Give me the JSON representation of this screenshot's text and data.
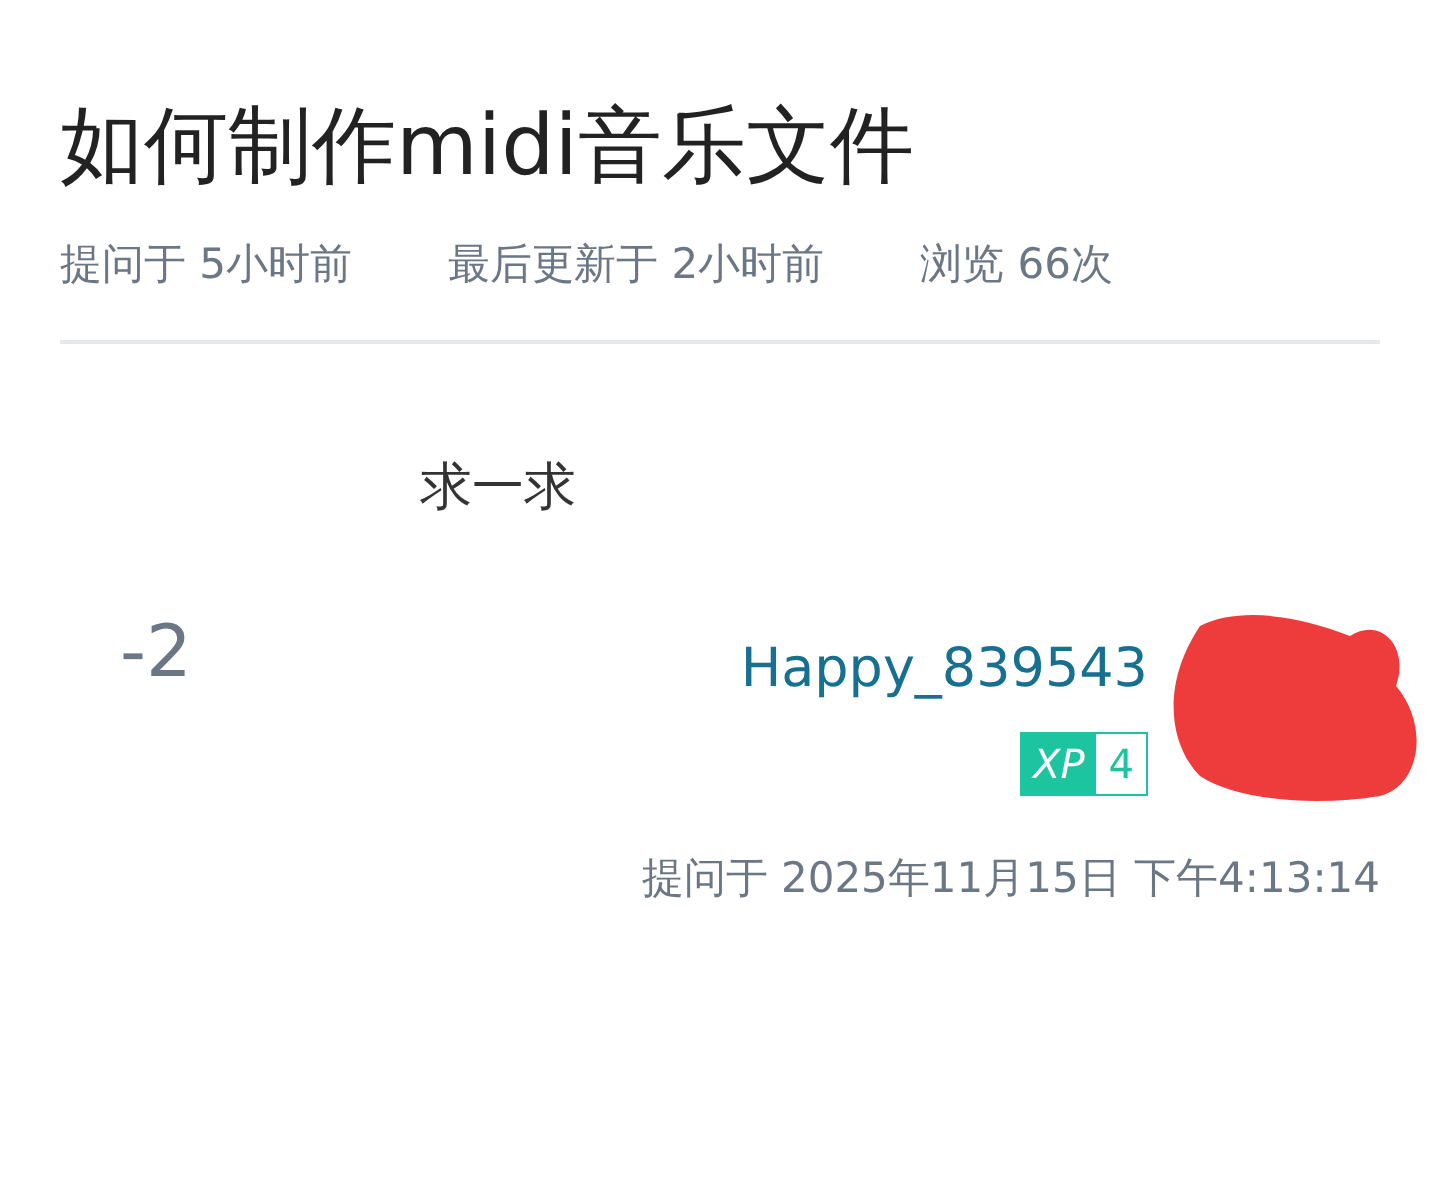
{
  "question": {
    "title": "如何制作midi音乐文件",
    "meta": [
      "提问于 5小时前",
      "最后更新于 2小时前",
      "浏览 66次"
    ]
  },
  "answer": {
    "body": "求一求",
    "votes": "-2",
    "author": "Happy_839543",
    "badge": {
      "label": "XP",
      "level": "4"
    },
    "asked": "提问于 2025年11月15日 下午4:13:14"
  }
}
